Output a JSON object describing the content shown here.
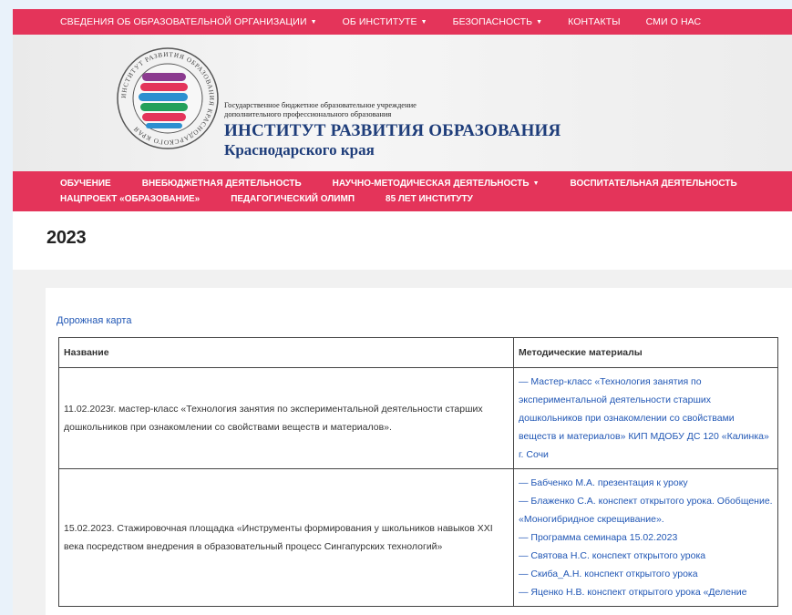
{
  "top_nav": [
    {
      "label": "СВЕДЕНИЯ ОБ ОБРАЗОВАТЕЛЬНОЙ ОРГАНИЗАЦИИ",
      "dropdown": true
    },
    {
      "label": "ОБ ИНСТИТУТЕ",
      "dropdown": true
    },
    {
      "label": "БЕЗОПАСНОСТЬ",
      "dropdown": true
    },
    {
      "label": "КОНТАКТЫ",
      "dropdown": false
    },
    {
      "label": "СМИ О НАС",
      "dropdown": false
    }
  ],
  "header": {
    "org_type_line1": "Государственное бюджетное образовательное учреждение",
    "org_type_line2": "дополнительного профессионального образования",
    "org_name": "ИНСТИТУТ РАЗВИТИЯ ОБРАЗОВАНИЯ",
    "org_region": "Краснодарского края",
    "logo_ring_text": "ИНСТИТУТ РАЗВИТИЯ ОБРАЗОВАНИЯ КРАСНОДАРСКОГО КРАЯ"
  },
  "main_nav": {
    "row1": [
      {
        "label": "ОБУЧЕНИЕ",
        "dropdown": false
      },
      {
        "label": "ВНЕБЮДЖЕТНАЯ ДЕЯТЕЛЬНОСТЬ",
        "dropdown": false
      },
      {
        "label": "НАУЧНО-МЕТОДИЧЕСКАЯ ДЕЯТЕЛЬНОСТЬ",
        "dropdown": true
      },
      {
        "label": "ВОСПИТАТЕЛЬНАЯ ДЕЯТЕЛЬНОСТЬ",
        "dropdown": false
      }
    ],
    "row2": [
      {
        "label": "НАЦПРОЕКТ «ОБРАЗОВАНИЕ»",
        "dropdown": false
      },
      {
        "label": "ПЕДАГОГИЧЕСКИЙ ОЛИМП",
        "dropdown": false
      },
      {
        "label": "85 ЛЕТ ИНСТИТУТУ",
        "dropdown": false
      }
    ]
  },
  "page_title": "2023",
  "roadmap_link": "Дорожная карта",
  "table": {
    "headers": [
      "Название",
      "Методические материалы"
    ],
    "rows": [
      {
        "name": "11.02.2023г. мастер-класс «Технология занятия по экспериментальной деятельности старших дошкольников при ознакомлении со свойствами веществ и материалов».",
        "materials": [
          "— Мастер-класс «Технология занятия по экспериментальной деятельности старших дошкольников при ознакомлении со свойствами веществ и материалов» КИП МДОБУ ДС 120 «Калинка» г. Сочи"
        ]
      },
      {
        "name": "15.02.2023. Стажировочная площадка «Инструменты формирования у школьников навыков XXI века посредством внедрения в образовательный процесс Сингапурских технологий»",
        "materials": [
          "— Бабченко М.А. презентация к уроку",
          "— Блаженко С.А. конспект открытого урока. Обобщение. «Моногибридное скрещивание».",
          "— Программа семинара 15.02.2023",
          "— Святова Н.С. конспект открытого урока",
          "— Скиба_А.Н. конспект открытого урока",
          "— Яценко Н.В. конспект открытого урока «Деление"
        ]
      }
    ]
  },
  "colors": {
    "nav_bg": "#e4345a",
    "title_blue": "#1e3d7a",
    "link_blue": "#2157b5"
  }
}
